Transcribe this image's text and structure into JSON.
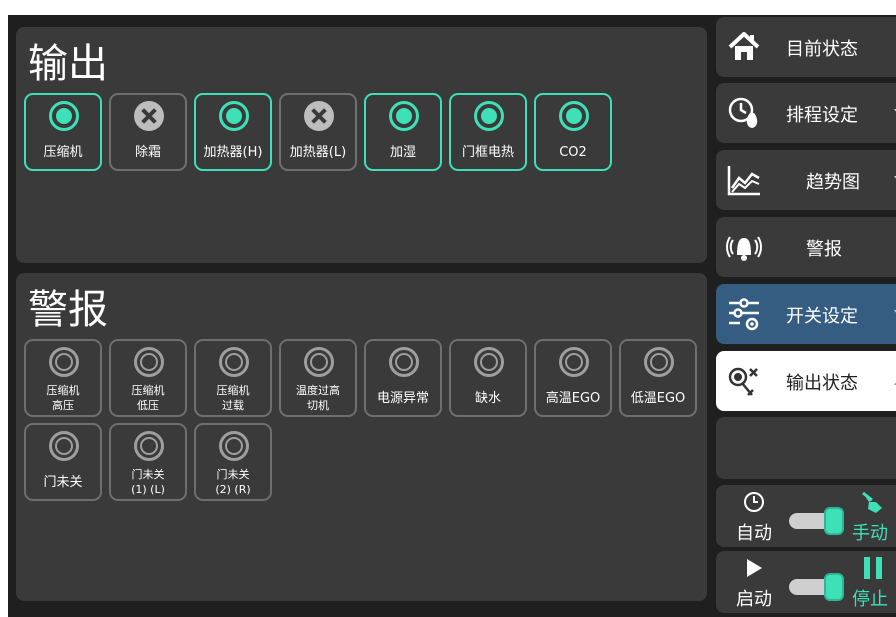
{
  "output": {
    "title": "输出",
    "items": [
      {
        "label": "压缩机",
        "state": "on"
      },
      {
        "label": "除霜",
        "state": "off"
      },
      {
        "label": "加热器(H)",
        "state": "on"
      },
      {
        "label": "加热器(L)",
        "state": "off"
      },
      {
        "label": "加湿",
        "state": "on"
      },
      {
        "label": "门框电热",
        "state": "on"
      },
      {
        "label": "CO2",
        "state": "on"
      }
    ]
  },
  "alarm": {
    "title": "警报",
    "items": [
      {
        "line1": "压缩机",
        "line2": "高压"
      },
      {
        "line1": "压缩机",
        "line2": "低压"
      },
      {
        "line1": "压缩机",
        "line2": "过载"
      },
      {
        "line1": "温度过高",
        "line2": "切机"
      },
      {
        "line1": "电源异常",
        "line2": ""
      },
      {
        "line1": "缺水",
        "line2": ""
      },
      {
        "line1": "高温EGO",
        "line2": ""
      },
      {
        "line1": "低温EGO",
        "line2": ""
      },
      {
        "line1": "门未关",
        "line2": ""
      },
      {
        "line1": "门未关",
        "line2": "(1) (L)"
      },
      {
        "line1": "门未关",
        "line2": "(2) (R)"
      }
    ]
  },
  "sidebar": {
    "items": [
      {
        "label": "目前状态",
        "icon": "home-icon"
      },
      {
        "label": "排程设定",
        "icon": "schedule-icon"
      },
      {
        "label": "趋势图",
        "icon": "trend-chart-icon"
      },
      {
        "label": "警报",
        "icon": "alarm-bell-icon"
      },
      {
        "label": "开关设定",
        "icon": "switch-settings-icon"
      },
      {
        "label": "输出状态",
        "icon": "output-status-icon"
      }
    ]
  },
  "mode_switch": {
    "left_label": "自动",
    "right_label": "手动",
    "value": "手动"
  },
  "run_switch": {
    "left_label": "启动",
    "right_label": "停止",
    "value": "停止"
  },
  "colors": {
    "accent": "#3ee0b8",
    "panel": "#3a3a3a",
    "background": "#1f1f1f",
    "selected_blue": "#355d82"
  }
}
